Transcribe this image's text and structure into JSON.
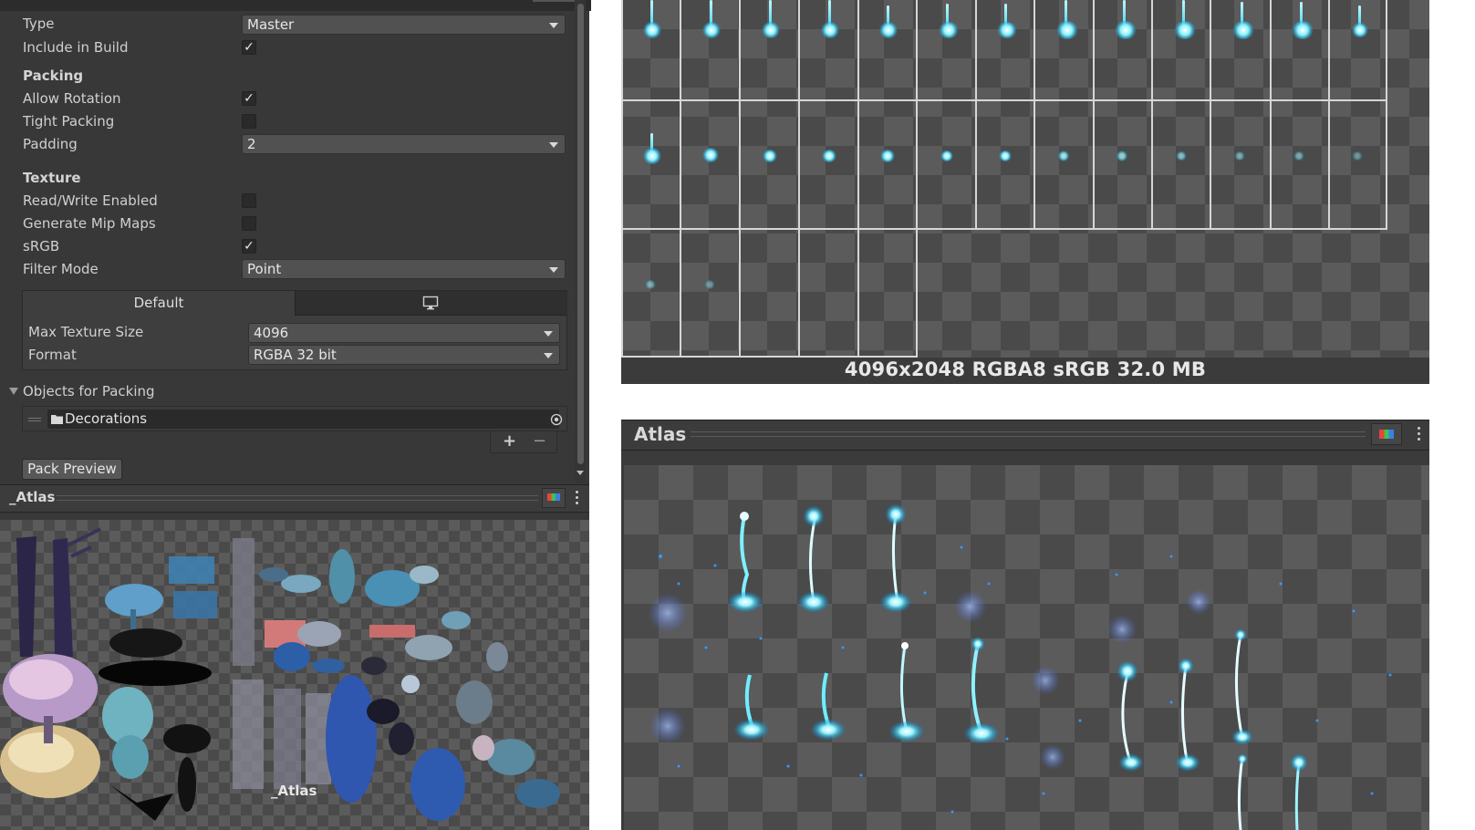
{
  "inspector": {
    "fields": {
      "type_label": "Type",
      "type_value": "Master",
      "include_label": "Include in Build",
      "include_checked": true
    },
    "packing": {
      "heading": "Packing",
      "allow_rotation_label": "Allow Rotation",
      "allow_rotation_checked": true,
      "tight_packing_label": "Tight Packing",
      "tight_packing_checked": false,
      "padding_label": "Padding",
      "padding_value": "2"
    },
    "texture": {
      "heading": "Texture",
      "readwrite_label": "Read/Write Enabled",
      "readwrite_checked": false,
      "mipmaps_label": "Generate Mip Maps",
      "mipmaps_checked": false,
      "srgb_label": "sRGB",
      "srgb_checked": true,
      "filter_label": "Filter Mode",
      "filter_value": "Point"
    },
    "platform": {
      "tab_default": "Default",
      "tab_pc_icon": "monitor-icon",
      "max_size_label": "Max Texture Size",
      "max_size_value": "4096",
      "format_label": "Format",
      "format_value": "RGBA 32 bit"
    },
    "objects": {
      "heading": "Objects for Packing",
      "item": "Decorations",
      "item_icon": "folder-icon",
      "add": "+",
      "remove": "−"
    },
    "pack_preview_button": "Pack Preview",
    "check_glyph": "✓"
  },
  "small_preview": {
    "title": "_Atlas",
    "watermark": "_Atlas",
    "icon": "color-channels-icon"
  },
  "grid_preview": {
    "info": "4096x2048  RGBA8 sRGB   32.0 MB"
  },
  "atlas_preview": {
    "title": "Atlas",
    "icon": "color-channels-icon"
  },
  "colors": {
    "panel_bg": "#383838",
    "spark_cyan": "#2fd3f0",
    "checker_dark": "#4a4a4a",
    "checker_light": "#5b5b5b"
  }
}
